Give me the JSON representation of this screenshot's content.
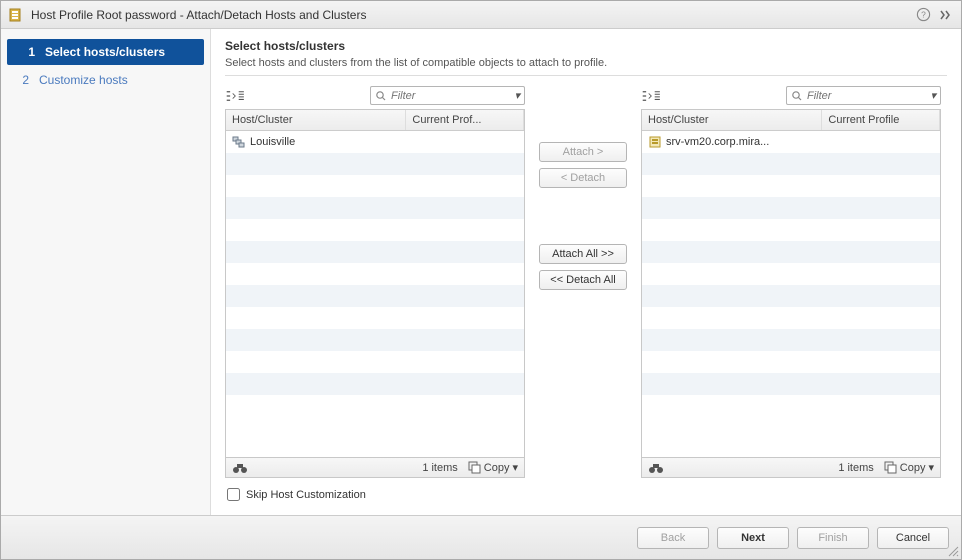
{
  "title": "Host Profile Root password - Attach/Detach Hosts and Clusters",
  "steps": [
    {
      "num": "1",
      "label": "Select hosts/clusters",
      "active": true
    },
    {
      "num": "2",
      "label": "Customize hosts",
      "active": false
    }
  ],
  "heading": "Select hosts/clusters",
  "subtitle": "Select hosts and clusters from the list of compatible objects to attach to profile.",
  "filter_placeholder": "Filter",
  "left_table": {
    "col1": "Host/Cluster",
    "col2": "Current Prof...",
    "rows": [
      {
        "name": "Louisville",
        "profile": "",
        "icon": "cluster"
      }
    ],
    "count_label": "1 items",
    "copy_label": "Copy"
  },
  "right_table": {
    "col1": "Host/Cluster",
    "col2": "Current Profile",
    "rows": [
      {
        "name": "srv-vm20.corp.mira...",
        "profile": "",
        "icon": "host"
      }
    ],
    "count_label": "1 items",
    "copy_label": "Copy"
  },
  "buttons": {
    "attach": "Attach >",
    "detach": "< Detach",
    "attach_all": "Attach All >>",
    "detach_all": "<< Detach All"
  },
  "skip_label": "Skip Host Customization",
  "footer": {
    "back": "Back",
    "next": "Next",
    "finish": "Finish",
    "cancel": "Cancel"
  }
}
